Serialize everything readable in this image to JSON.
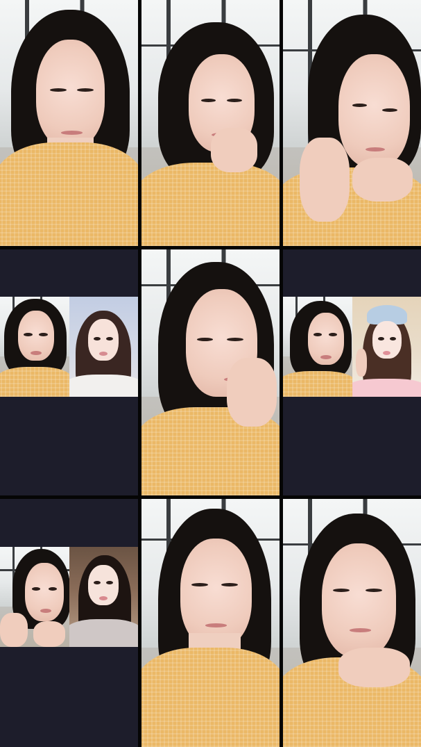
{
  "grid": {
    "columns": 3,
    "rows": 3,
    "background": "#050505",
    "empty_cell_color": "#1d1d2b",
    "shirt_color": "#ebb866",
    "hair_color": "#15110f"
  },
  "tiles": [
    {
      "type": "video",
      "pose": "looking-down"
    },
    {
      "type": "video",
      "pose": "chin-on-hand"
    },
    {
      "type": "video",
      "pose": "hands-under-chin"
    },
    {
      "type": "duet",
      "partner": "long-dark-hair"
    },
    {
      "type": "video",
      "pose": "finger-on-lip"
    },
    {
      "type": "duet",
      "partner": "blue-cap"
    },
    {
      "type": "duet",
      "partner": "dark-room"
    },
    {
      "type": "video",
      "pose": "front-facing"
    },
    {
      "type": "video",
      "pose": "hands-under-chin"
    }
  ]
}
